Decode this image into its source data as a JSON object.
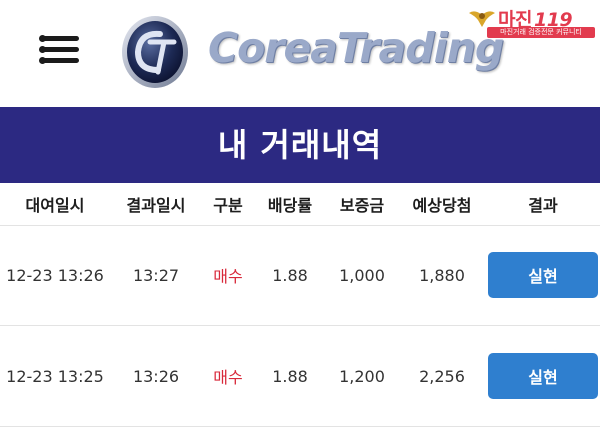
{
  "header": {
    "logo_text": "CoreaTrading",
    "badge": {
      "name": "마진",
      "tag": "119",
      "subtitle": "마진거래 검증전문 커뮤니티"
    }
  },
  "page_title": "내 거래내역",
  "colors": {
    "title_bar": "#2c2982",
    "type_text": "#d8283a",
    "result_button": "#2f7fcf",
    "badge": "#e23b4e"
  },
  "table": {
    "headers": [
      "대여일시",
      "결과일시",
      "구분",
      "배당률",
      "보증금",
      "예상당첨",
      "결과"
    ],
    "rows": [
      {
        "rent_time": "12-23 13:26",
        "result_time": "13:27",
        "type": "매수",
        "rate": "1.88",
        "deposit": "1,000",
        "expected": "1,880",
        "result": "실현"
      },
      {
        "rent_time": "12-23 13:25",
        "result_time": "13:26",
        "type": "매수",
        "rate": "1.88",
        "deposit": "1,200",
        "expected": "2,256",
        "result": "실현"
      }
    ]
  }
}
